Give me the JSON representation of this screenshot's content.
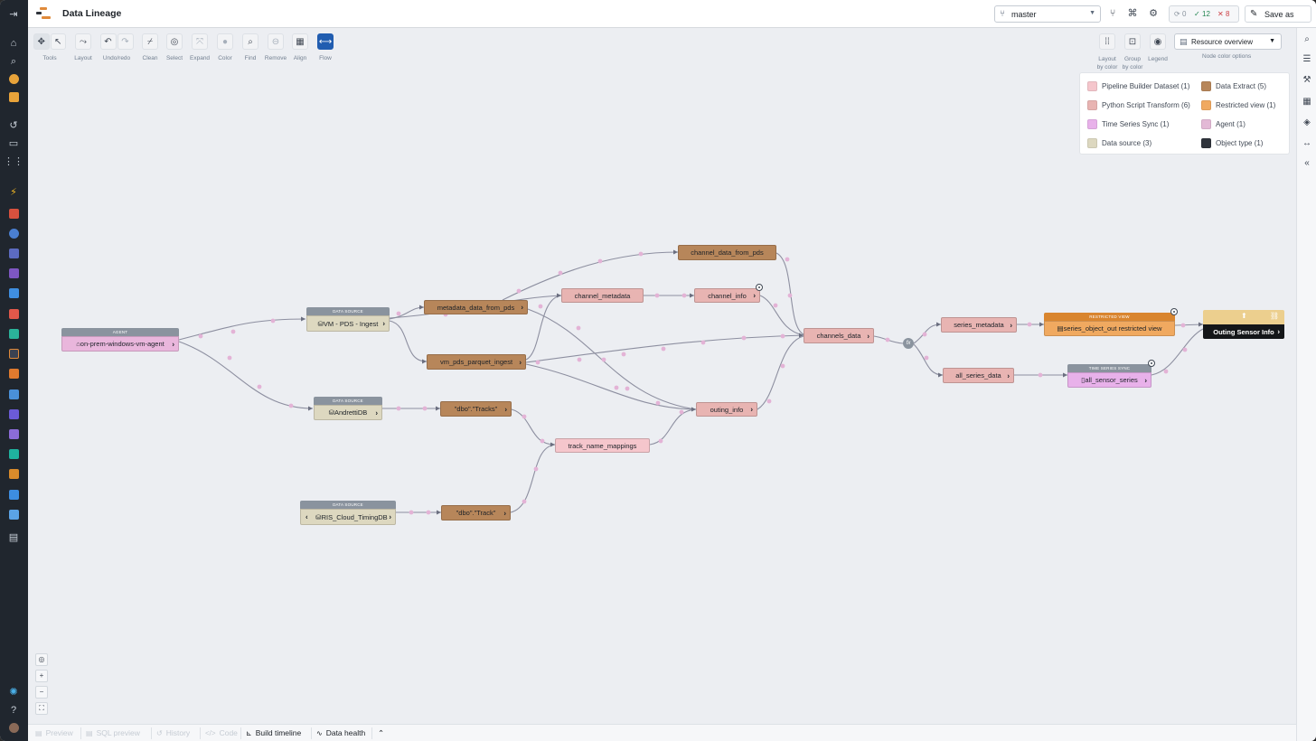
{
  "app": {
    "title": "Data Lineage",
    "branch": "master",
    "status": {
      "pending": "0",
      "success": "12",
      "failed": "8"
    },
    "save_label": "Save as"
  },
  "toolbar": {
    "tools": [
      "Tools",
      "Layout",
      "Undo/redo",
      "Clean",
      "Select",
      "Expand",
      "Color",
      "Find",
      "Remove",
      "Align",
      "Flow"
    ],
    "right_tools": [
      "Layout by color",
      "Group by color",
      "Legend"
    ],
    "resource_select": "Resource overview",
    "resource_caption": "Node color options"
  },
  "legend": {
    "items": [
      {
        "label": "Pipeline Builder Dataset (1)",
        "color": "#f5c6cc"
      },
      {
        "label": "Data Extract (5)",
        "color": "#b7865a"
      },
      {
        "label": "Python Script Transform (6)",
        "color": "#e8b4b2"
      },
      {
        "label": "Restricted view (1)",
        "color": "#f0a960"
      },
      {
        "label": "Time Series Sync (1)",
        "color": "#e8b1ea"
      },
      {
        "label": "Agent (1)",
        "color": "#e3b9d6"
      },
      {
        "label": "Data source (3)",
        "color": "#ddd8c0"
      },
      {
        "label": "Object type (1)",
        "color": "#2f343c"
      }
    ]
  },
  "nodes": {
    "agent": {
      "header": "AGENT",
      "label": "on-prem-windows-vm-agent"
    },
    "vm_pds": {
      "header": "DATA SOURCE",
      "label": "VM - PDS - Ingest"
    },
    "andretti": {
      "header": "DATA SOURCE",
      "label": "AndrettiDB"
    },
    "ris": {
      "header": "DATA SOURCE",
      "label": "RIS_Cloud_TimingDB"
    },
    "metadata_from_pds": {
      "label": "metadata_data_from_pds"
    },
    "vm_pds_parquet": {
      "label": "vm_pds_parquet_ingest"
    },
    "dbo_tracks": {
      "label": "\"dbo\".\"Tracks\""
    },
    "dbo_track": {
      "label": "\"dbo\".\"Track\""
    },
    "channel_data_from_pds": {
      "label": "channel_data_from_pds"
    },
    "channel_metadata": {
      "label": "channel_metadata"
    },
    "channel_info": {
      "label": "channel_info"
    },
    "outing_info": {
      "label": "outing_info"
    },
    "track_name_mappings": {
      "label": "track_name_mappings"
    },
    "channels_data": {
      "label": "channels_data"
    },
    "fx": {
      "label": "fx"
    },
    "series_metadata": {
      "label": "series_metadata"
    },
    "all_series_data": {
      "label": "all_series_data"
    },
    "restricted": {
      "header": "RESTRICTED VIEW",
      "label": "series_object_out restricted view"
    },
    "ts_sync": {
      "header": "TIME SERIES SYNC",
      "label": "all_sensor_series"
    },
    "object_type": {
      "label": "Outing Sensor Info"
    }
  },
  "bottom_tabs": [
    "Preview",
    "SQL preview",
    "History",
    "Code",
    "Build timeline",
    "Data health"
  ]
}
